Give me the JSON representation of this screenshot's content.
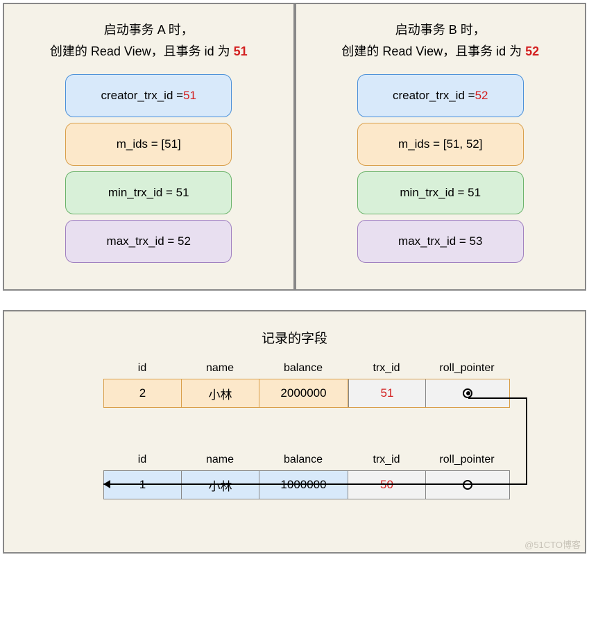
{
  "panelA": {
    "title_line1": "启动事务 A 时，",
    "title_line2_pre": "创建的 Read View，且事务 id 为 ",
    "title_id": "51",
    "creator_label": "creator_trx_id = ",
    "creator_val": "51",
    "mids": "m_ids = [51]",
    "min": "min_trx_id = 51",
    "max": "max_trx_id = 52"
  },
  "panelB": {
    "title_line1": "启动事务 B 时，",
    "title_line2_pre": "创建的 Read View，且事务 id 为 ",
    "title_id": "52",
    "creator_label": "creator_trx_id = ",
    "creator_val": "52",
    "mids": "m_ids = [51, 52]",
    "min": "min_trx_id = 51",
    "max": "max_trx_id = 53"
  },
  "bottom": {
    "title": "记录的字段",
    "headers": {
      "id": "id",
      "name": "name",
      "balance": "balance",
      "trx": "trx_id",
      "roll": "roll_pointer"
    },
    "row1": {
      "id": "2",
      "name": "小林",
      "balance": "2000000",
      "trx": "51"
    },
    "row2": {
      "id": "1",
      "name": "小林",
      "balance": "1000000",
      "trx": "50"
    },
    "watermark": "@51CTO博客"
  }
}
